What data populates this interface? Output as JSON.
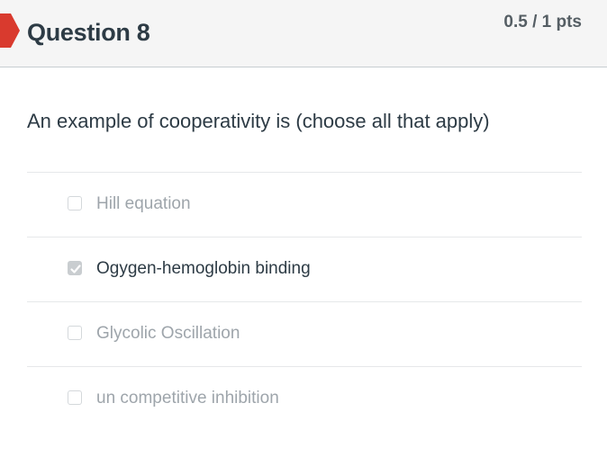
{
  "header": {
    "title": "Question 8",
    "points": "0.5 / 1 pts",
    "flag_color": "#d93a2e"
  },
  "question": {
    "text": "An example of cooperativity is (choose all that apply)"
  },
  "answers": [
    {
      "label": "Hill equation",
      "checked": false
    },
    {
      "label": "Ogygen-hemoglobin binding",
      "checked": true
    },
    {
      "label": "Glycolic Oscillation",
      "checked": false
    },
    {
      "label": "un competitive inhibition",
      "checked": false
    }
  ]
}
